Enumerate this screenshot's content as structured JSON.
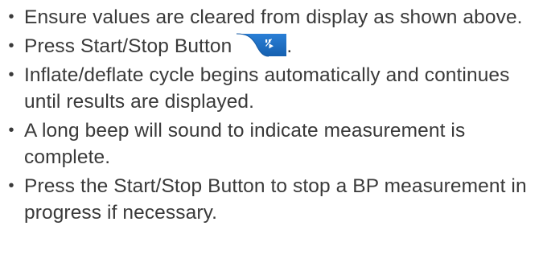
{
  "instructions": [
    {
      "text": "Ensure values are cleared from display as shown above."
    },
    {
      "text_before": "Press Start/Stop Button",
      "icon": "start-stop-icon",
      "text_after": "."
    },
    {
      "text": "Inflate/deflate cycle begins automatically and continues until results are displayed."
    },
    {
      "text": "A long beep will sound to indicate measurement is complete."
    },
    {
      "text": "Press the Start/Stop Button to stop a BP measurement in progress if necessary."
    }
  ],
  "colors": {
    "text": "#3a3a3a",
    "button_blue": "#1f6fc4",
    "button_blue_dark": "#165aa3"
  },
  "bullet_glyph": "•"
}
